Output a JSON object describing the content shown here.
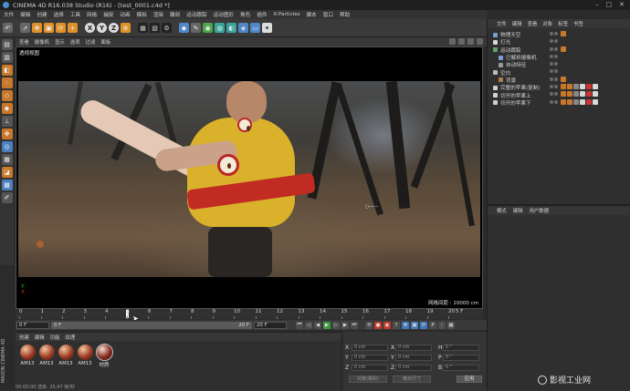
{
  "window": {
    "title": "CINEMA 4D R16.038 Studio (R16) - [test_0001.c4d *]",
    "controls": [
      "–",
      "□",
      "✕"
    ]
  },
  "menubar": [
    "文件",
    "编辑",
    "创建",
    "选择",
    "工具",
    "网格",
    "捕捉",
    "动画",
    "模拟",
    "渲染",
    "雕刻",
    "运动跟踪",
    "运动图形",
    "角色",
    "插件",
    "X-Particles",
    "脚本",
    "窗口",
    "帮助"
  ],
  "toolbar": {
    "axis_x": "X",
    "axis_y": "Y",
    "axis_z": "Z"
  },
  "viewport": {
    "menu": [
      "查看",
      "摄像机",
      "显示",
      "选项",
      "过滤",
      "面板"
    ],
    "label": "透视视图",
    "grid_readout": "网格间距 : 10000 cm",
    "axis_x": "X",
    "axis_y": "Y"
  },
  "timeline": {
    "ticks": [
      "0",
      "1",
      "2",
      "3",
      "4",
      "5",
      "6",
      "7",
      "8",
      "9",
      "10",
      "11",
      "12",
      "13",
      "14",
      "15",
      "16",
      "17",
      "18",
      "19",
      "20"
    ],
    "end_marker": "5 F",
    "current_frame": 5
  },
  "transport": {
    "start_field": "0 F",
    "range_start": "0 F",
    "range_end": "20 F",
    "end_field": "20 F"
  },
  "materials": {
    "menu": [
      "创建",
      "编辑",
      "功能",
      "纹理"
    ],
    "items": [
      "AM13",
      "AM13",
      "AM13",
      "AM13",
      "材质"
    ]
  },
  "branding": {
    "maxon": "MAXON CINEMA 4D"
  },
  "statusbar": "00:00:00  渲染: 25.47 帧/秒",
  "coordinates": {
    "rows": [
      {
        "a": "X",
        "av": "0 cm",
        "b": "X",
        "bv": "0 cm",
        "c": "H",
        "cv": "0 °"
      },
      {
        "a": "Y",
        "av": "0 cm",
        "b": "Y",
        "bv": "0 cm",
        "c": "P",
        "cv": "0 °"
      },
      {
        "a": "Z",
        "av": "0 cm",
        "b": "Z",
        "bv": "0 cm",
        "c": "B",
        "cv": "0 °"
      }
    ],
    "mode_a": "对象(相对)",
    "mode_b": "绝对尺寸",
    "apply": "应用"
  },
  "object_manager": {
    "menu": [
      "文件",
      "编辑",
      "查看",
      "对象",
      "标签",
      "书签"
    ],
    "objects": [
      {
        "name": "物理天空",
        "indent": 0,
        "color": "#7a9ed0"
      },
      {
        "name": "灯光",
        "indent": 0,
        "color": "#d8d8d8"
      },
      {
        "name": "运动跟踪",
        "indent": 0,
        "color": "#5fa36f"
      },
      {
        "name": "已解析摄像机",
        "indent": 1,
        "color": "#7a9ed0"
      },
      {
        "name": "自动特征",
        "indent": 1,
        "color": "#999"
      },
      {
        "name": "空白",
        "indent": 0,
        "color": "#bbb"
      },
      {
        "name": "背景",
        "indent": 1,
        "color": "#b07d4a"
      },
      {
        "name": "完整的苹果(复制)",
        "indent": 0,
        "color": "#d0d0d0"
      },
      {
        "name": "切开的苹果上",
        "indent": 0,
        "color": "#d0d0d0"
      },
      {
        "name": "切开的苹果下",
        "indent": 0,
        "color": "#d0d0d0"
      }
    ]
  },
  "attribute_manager": {
    "menu": [
      "模式",
      "编辑",
      "用户数据"
    ]
  },
  "watermark": "影视工业网"
}
